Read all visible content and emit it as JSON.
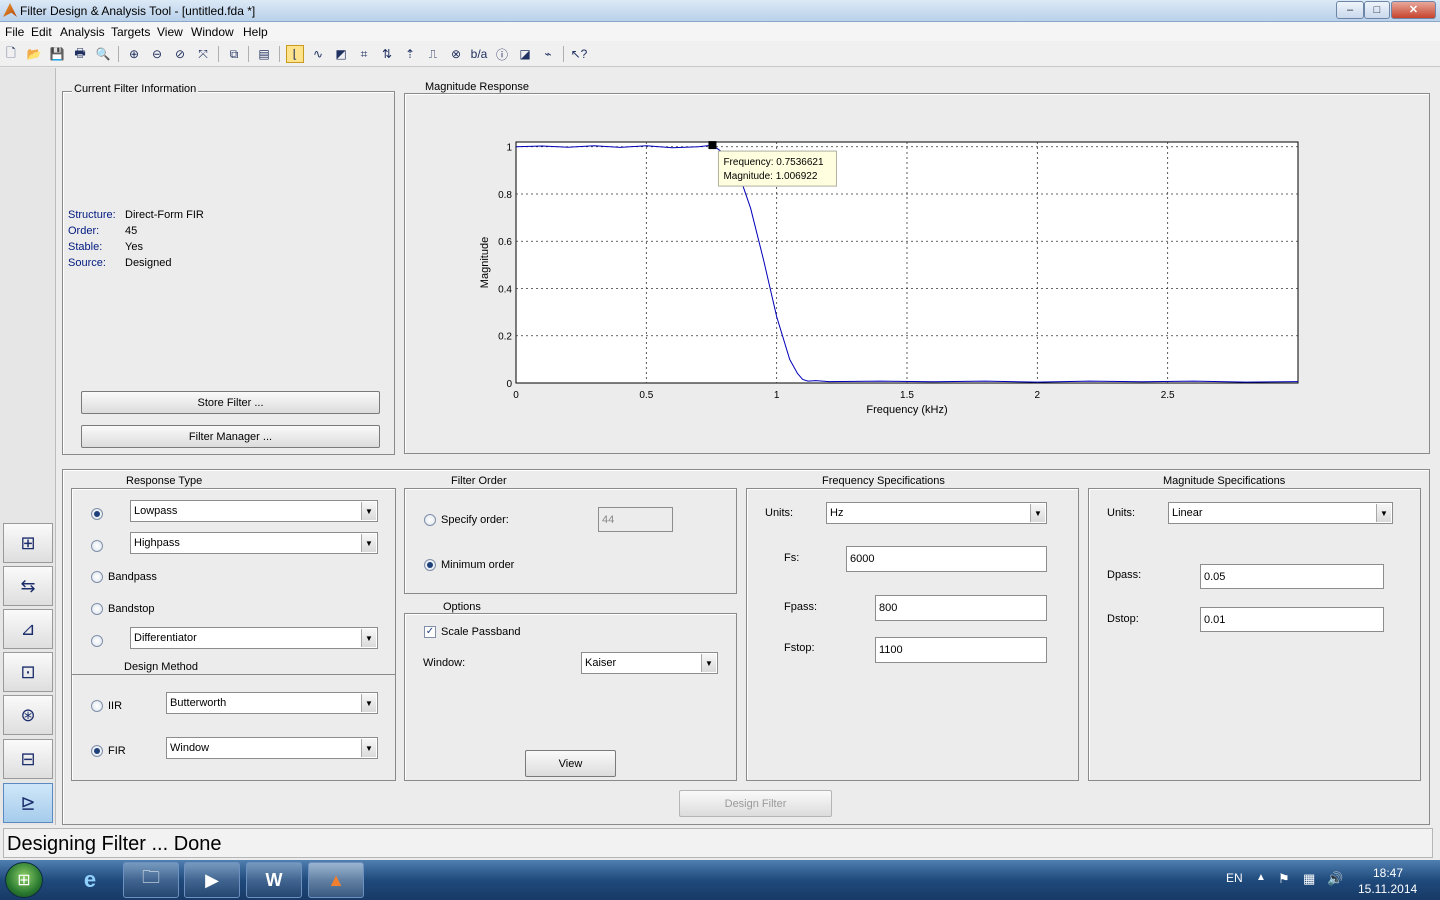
{
  "window": {
    "title": "Filter Design & Analysis Tool -  [untitled.fda *]",
    "min": "–",
    "max": "□",
    "close": "✕"
  },
  "menu": [
    "File",
    "Edit",
    "Analysis",
    "Targets",
    "View",
    "Window",
    "Help"
  ],
  "info": {
    "title": "Current Filter Information",
    "rows": [
      {
        "key": "Structure:",
        "value": "Direct-Form FIR"
      },
      {
        "key": "Order:",
        "value": "45"
      },
      {
        "key": "Stable:",
        "value": "Yes"
      },
      {
        "key": "Source:",
        "value": "Designed"
      }
    ],
    "store_btn": "Store Filter ...",
    "manager_btn": "Filter Manager ..."
  },
  "plot": {
    "title": "Magnitude Response"
  },
  "chart_data": {
    "type": "line",
    "xlabel": "Frequency (kHz)",
    "ylabel": "Magnitude",
    "xlim": [
      0,
      3
    ],
    "ylim": [
      0,
      1.02
    ],
    "xticks": [
      "0",
      "0.5",
      "1",
      "1.5",
      "2",
      "2.5"
    ],
    "yticks": [
      "0",
      "0.2",
      "0.4",
      "0.6",
      "0.8",
      "1"
    ],
    "grid": true,
    "series": [
      {
        "color": "#0000b8",
        "x": [
          0,
          0.1,
          0.2,
          0.3,
          0.4,
          0.5,
          0.6,
          0.7,
          0.7537,
          0.8,
          0.85,
          0.9,
          0.95,
          1.0,
          1.05,
          1.08,
          1.1,
          1.12,
          1.15,
          1.2,
          1.4,
          1.6,
          1.8,
          2.0,
          2.2,
          2.4,
          2.6,
          2.8,
          3.0
        ],
        "y": [
          1.0,
          1.003,
          0.998,
          1.004,
          0.997,
          1.004,
          0.996,
          1.0,
          1.0069,
          0.97,
          0.9,
          0.74,
          0.52,
          0.28,
          0.1,
          0.04,
          0.015,
          0.008,
          0.01,
          0.006,
          0.008,
          0.005,
          0.008,
          0.004,
          0.008,
          0.005,
          0.008,
          0.004,
          0.006
        ]
      }
    ],
    "datatip": {
      "x": 0.7536621,
      "y": 1.006922,
      "lines": [
        "Frequency: 0.7536621",
        "Magnitude: 1.006922"
      ]
    }
  },
  "response_type": {
    "title": "Response Type",
    "options": [
      "Lowpass",
      "Highpass",
      "Bandpass",
      "Bandstop",
      "Differentiator"
    ],
    "lowpass_value": "Lowpass",
    "highpass_value": "Highpass",
    "diff_value": "Differentiator"
  },
  "design_method": {
    "title": "Design Method",
    "iir_label": "IIR",
    "iir_value": "Butterworth",
    "fir_label": "FIR",
    "fir_value": "Window"
  },
  "filter_order": {
    "title": "Filter Order",
    "specify_label": "Specify order:",
    "specify_value": "44",
    "minimum_label": "Minimum order"
  },
  "options": {
    "title": "Options",
    "scale_label": "Scale Passband",
    "window_label": "Window:",
    "window_value": "Kaiser",
    "view_btn": "View"
  },
  "freq_specs": {
    "title": "Frequency Specifications",
    "units_label": "Units:",
    "units_value": "Hz",
    "fs_label": "Fs:",
    "fs_value": "6000",
    "fpass_label": "Fpass:",
    "fpass_value": "800",
    "fstop_label": "Fstop:",
    "fstop_value": "1100"
  },
  "mag_specs": {
    "title": "Magnitude Specifications",
    "units_label": "Units:",
    "units_value": "Linear",
    "dpass_label": "Dpass:",
    "dpass_value": "0.05",
    "dstop_label": "Dstop:",
    "dstop_value": "0.01"
  },
  "design_btn": "Design Filter",
  "status": "Designing Filter ... Done",
  "taskbar": {
    "lang": "EN",
    "time": "18:47",
    "date": "15.11.2014"
  }
}
